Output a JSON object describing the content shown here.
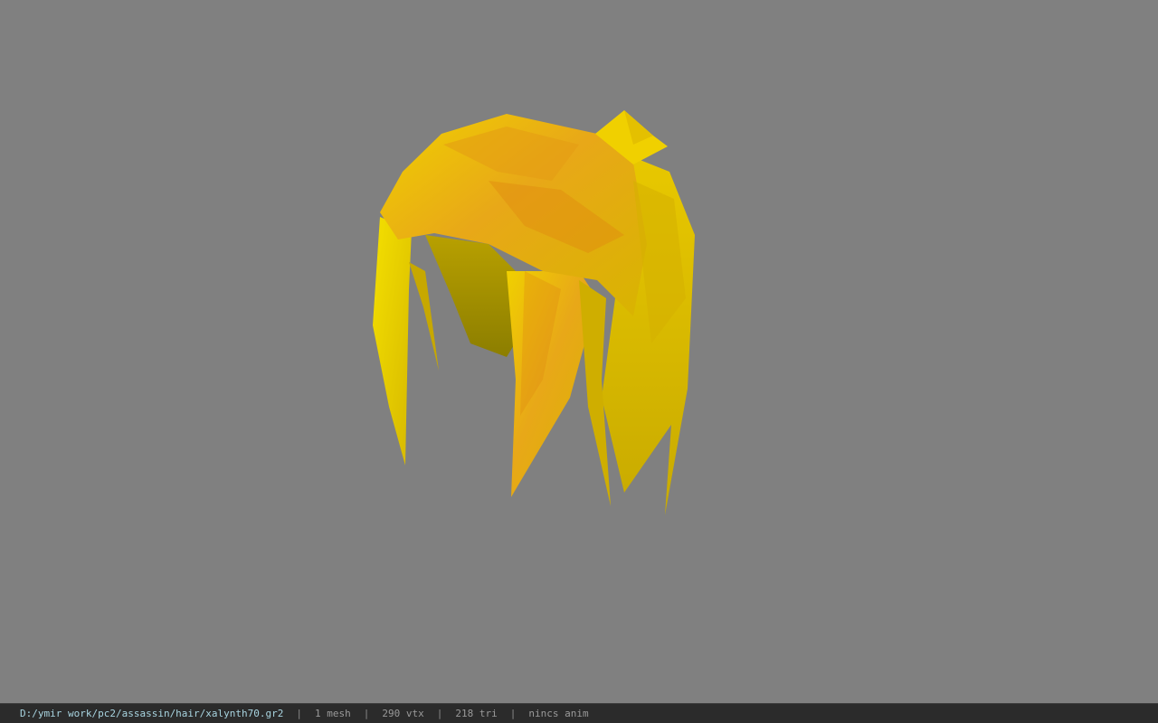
{
  "status_bar": {
    "file_path": "D:/ymir work/pc2/assassin/hair/xalynth70.gr2",
    "separator": "|",
    "mesh_count": "1 mesh",
    "vertex_count": "290 vtx",
    "triangle_count": "218 tri",
    "animation_status": "nincs anim"
  },
  "colors": {
    "background": "#808080",
    "status_bar_bg": "#2b2b2b",
    "path_text": "#a8d4e0",
    "stat_text": "#9a9a9a",
    "hair_base": "#e6c400",
    "hair_streak": "#e08a10",
    "hair_shadow": "#9a8a00"
  },
  "model": {
    "icon": "hair-mesh-icon"
  }
}
